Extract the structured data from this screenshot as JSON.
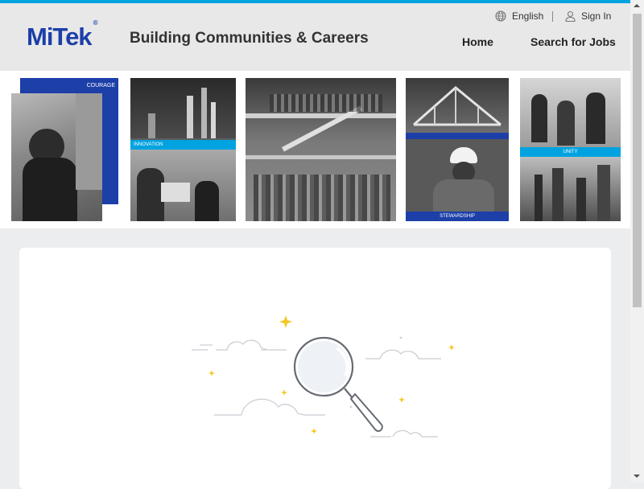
{
  "header": {
    "logo_text": "MiTek",
    "logo_mark": "®",
    "tagline": "Building Communities & Careers",
    "language_label": "English",
    "signin_label": "Sign In",
    "nav": [
      "Home",
      "Search for Jobs"
    ]
  },
  "banner": {
    "panels": [
      {
        "caption": "COURAGE"
      },
      {
        "caption": "INNOVATION"
      },
      {
        "caption": ""
      },
      {
        "caption": "STEWARDSHIP"
      },
      {
        "caption": "UNITY"
      }
    ]
  },
  "colors": {
    "accent_cyan": "#00a3e0",
    "brand_blue": "#1c3fa8",
    "header_bg": "#e8e8e8",
    "page_bg": "#ecedee"
  },
  "icons": [
    "globe-icon",
    "user-icon",
    "magnifier-illustration",
    "sparkle-icon",
    "cloud-icon"
  ]
}
